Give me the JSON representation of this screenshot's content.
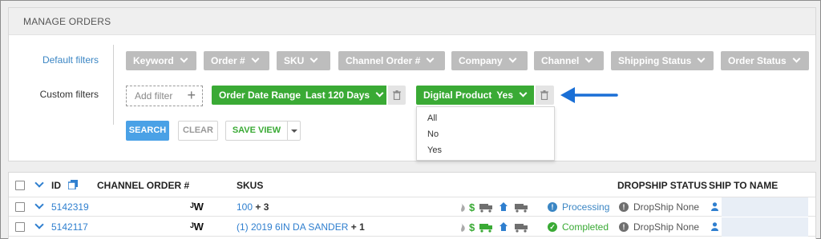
{
  "panel": {
    "title": "MANAGE ORDERS"
  },
  "filters": {
    "default_label": "Default filters",
    "custom_label": "Custom filters",
    "default": [
      "Keyword",
      "Order #",
      "SKU",
      "Channel Order #",
      "Company",
      "Channel",
      "Shipping Status",
      "Order Status"
    ],
    "add_filter": "Add filter",
    "custom": [
      {
        "name": "Order Date Range",
        "value": "Last 120 Days"
      },
      {
        "name": "Digital Product",
        "value": "Yes"
      }
    ],
    "dropdown_options": [
      "All",
      "No",
      "Yes"
    ]
  },
  "actions": {
    "search": "SEARCH",
    "clear": "CLEAR",
    "save_view": "SAVE VIEW"
  },
  "table": {
    "headers": {
      "id": "ID",
      "channel_order": "CHANNEL ORDER #",
      "skus": "SKUS",
      "dropship": "DROPSHIP STATUS",
      "ship_to": "SHIP TO NAME"
    },
    "rows": [
      {
        "id": "5142319",
        "channel_logo": "ᴶW",
        "sku": "100",
        "sku_extra": "+ 3",
        "status": "Processing",
        "status_color": "#3b86c4",
        "dropship": "DropShip None"
      },
      {
        "id": "5142117",
        "channel_logo": "ᴶW",
        "sku": "(1) 2019 6IN DA SANDER",
        "sku_extra": "+ 1",
        "status": "Completed",
        "status_color": "#3aaa35",
        "dropship": "DropShip None"
      }
    ]
  },
  "colors": {
    "accent": "#4aa1e6",
    "green": "#3aaa35",
    "gray_button": "#bdbdbd",
    "arrow": "#1a6fd6"
  }
}
